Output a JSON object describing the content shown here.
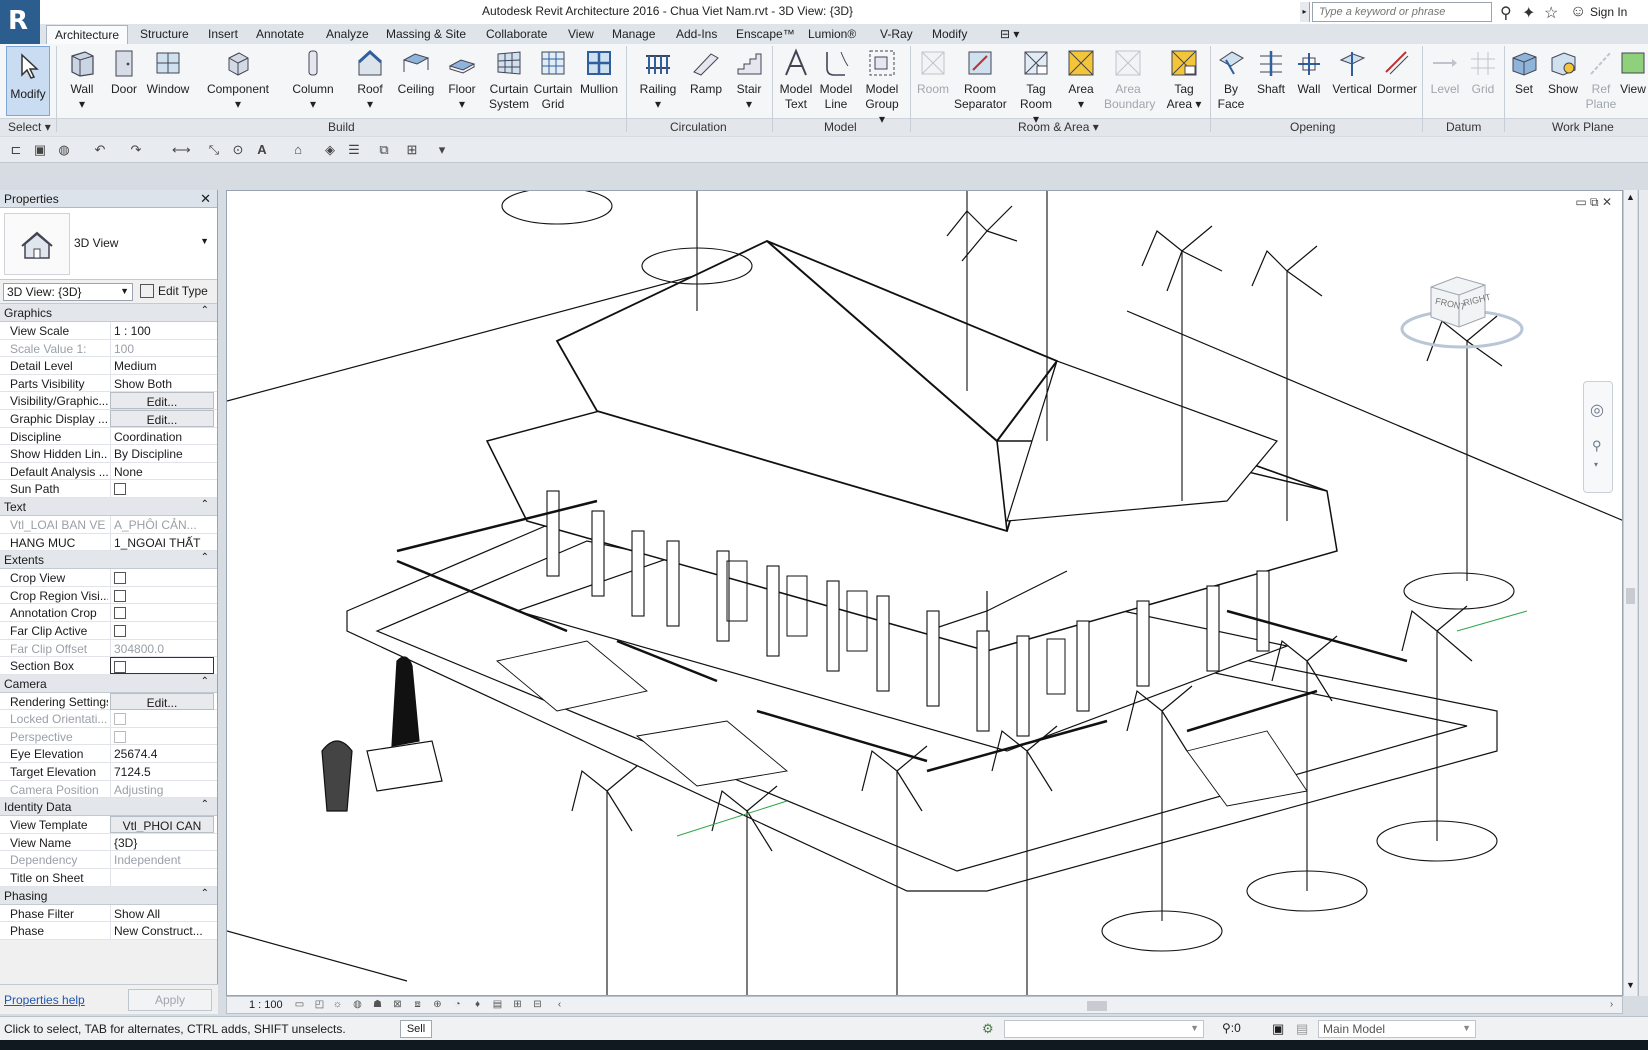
{
  "title_bar": {
    "title": "Autodesk Revit Architecture 2016 -    Chua Viet Nam.rvt - 3D View: {3D}",
    "search_placeholder": "Type a keyword or phrase",
    "sign_in": "Sign In"
  },
  "ribbon": {
    "tabs": [
      "Architecture",
      "Structure",
      "Insert",
      "Annotate",
      "Analyze",
      "Massing & Site",
      "Collaborate",
      "View",
      "Manage",
      "Add-Ins",
      "Enscape™",
      "Lumion®",
      "V-Ray",
      "Modify"
    ],
    "active_tab": "Architecture",
    "modify": "Modify",
    "select_panel": "Select",
    "build": {
      "label": "Build",
      "buttons": [
        "Wall",
        "Door",
        "Window",
        "Component",
        "Column",
        "Roof",
        "Ceiling",
        "Floor",
        "Curtain System",
        "Curtain Grid",
        "Mullion"
      ]
    },
    "circulation": {
      "label": "Circulation",
      "buttons": [
        "Railing",
        "Ramp",
        "Stair"
      ]
    },
    "model": {
      "label": "Model",
      "buttons": [
        "Model Text",
        "Model Line",
        "Model Group"
      ]
    },
    "room_area": {
      "label": "Room & Area",
      "buttons": [
        "Room",
        "Room Separator",
        "Tag Room",
        "Area",
        "Area Boundary",
        "Tag Area"
      ]
    },
    "opening": {
      "label": "Opening",
      "buttons": [
        "By Face",
        "Shaft",
        "Wall",
        "Vertical",
        "Dormer"
      ]
    },
    "datum": {
      "label": "Datum",
      "buttons": [
        "Level",
        "Grid"
      ]
    },
    "work_plane": {
      "label": "Work Plane",
      "buttons": [
        "Set",
        "Show",
        "Ref Plane",
        "View"
      ]
    }
  },
  "properties": {
    "title": "Properties",
    "type_name": "3D View",
    "view_selector": "3D View: {3D}",
    "edit_type": "Edit Type",
    "groups": {
      "graphics": "Graphics",
      "text": "Text",
      "extents": "Extents",
      "camera": "Camera",
      "identity": "Identity Data",
      "phasing": "Phasing"
    },
    "rows": {
      "view_scale": [
        "View Scale",
        "1 : 100"
      ],
      "scale_value": [
        "Scale Value    1:",
        "100"
      ],
      "detail_level": [
        "Detail Level",
        "Medium"
      ],
      "parts_visibility": [
        "Parts Visibility",
        "Show Both"
      ],
      "visibility_graphic": [
        "Visibility/Graphic...",
        "Edit..."
      ],
      "graphic_display": [
        "Graphic Display ...",
        "Edit..."
      ],
      "discipline": [
        "Discipline",
        "Coordination"
      ],
      "show_hidden": [
        "Show Hidden Lin...",
        "By Discipline"
      ],
      "default_analysis": [
        "Default Analysis ...",
        "None"
      ],
      "sun_path": [
        "Sun Path",
        ""
      ],
      "loai_ban_ve": [
        "Vtl_LOAI BAN VE",
        "A_PHÔI CẢN..."
      ],
      "hang_muc": [
        "HANG MUC",
        "1_NGOAI THẤT"
      ],
      "crop_view": [
        "Crop View",
        ""
      ],
      "crop_region": [
        "Crop Region Visi...",
        ""
      ],
      "annotation_crop": [
        "Annotation Crop",
        ""
      ],
      "far_clip_active": [
        "Far Clip Active",
        ""
      ],
      "far_clip_offset": [
        "Far Clip Offset",
        "304800.0"
      ],
      "section_box": [
        "Section Box",
        ""
      ],
      "rendering_settings": [
        "Rendering Settings",
        "Edit..."
      ],
      "locked_orientation": [
        "Locked Orientati...",
        ""
      ],
      "perspective": [
        "Perspective",
        ""
      ],
      "eye_elevation": [
        "Eye Elevation",
        "25674.4"
      ],
      "target_elevation": [
        "Target Elevation",
        "7124.5"
      ],
      "camera_position": [
        "Camera Position",
        "Adjusting"
      ],
      "view_template": [
        "View Template",
        "Vtl_PHOI CAN"
      ],
      "view_name": [
        "View Name",
        "{3D}"
      ],
      "dependency": [
        "Dependency",
        "Independent"
      ],
      "title_on_sheet": [
        "Title on Sheet",
        ""
      ],
      "phase_filter": [
        "Phase Filter",
        "Show All"
      ],
      "phase": [
        "Phase",
        "New Construct..."
      ]
    },
    "help": "Properties help",
    "apply": "Apply"
  },
  "viewport": {
    "scale": "1 : 100",
    "viewcube_front": "FRONT",
    "viewcube_right": "RIGHT"
  },
  "status_bar": {
    "hint": "Click to select, TAB for alternates, CTRL adds, SHIFT unselects.",
    "selection": "Sell",
    "filter_count": ":0",
    "model": "Main Model"
  }
}
